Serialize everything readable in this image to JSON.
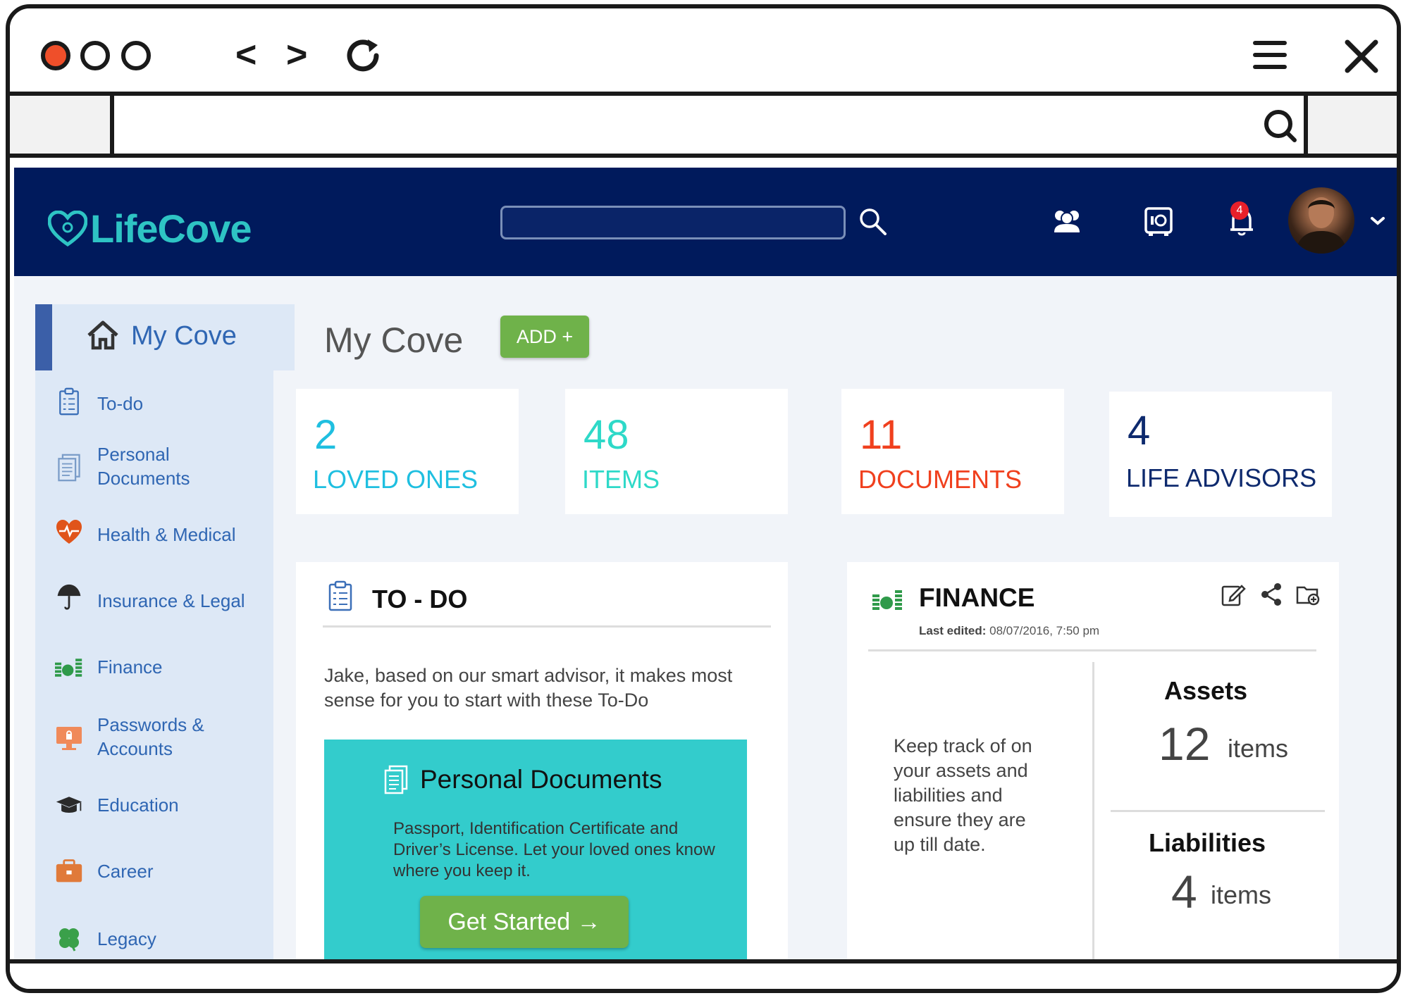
{
  "browser": {
    "nav_back": "<",
    "nav_forward": ">"
  },
  "header": {
    "logo_text": "LifeCove",
    "notification_count": "4"
  },
  "sidebar": {
    "active_label": "My Cove",
    "items": [
      {
        "label": "To-do",
        "icon": "clipboard-icon"
      },
      {
        "label": "Personal Documents",
        "icon": "documents-icon"
      },
      {
        "label": "Health & Medical",
        "icon": "heart-icon"
      },
      {
        "label": "Insurance & Legal",
        "icon": "umbrella-icon"
      },
      {
        "label": "Finance",
        "icon": "money-icon"
      },
      {
        "label": "Passwords & Accounts",
        "icon": "monitor-lock-icon"
      },
      {
        "label": "Education",
        "icon": "graduation-cap-icon"
      },
      {
        "label": "Career",
        "icon": "briefcase-icon"
      },
      {
        "label": "Legacy",
        "icon": "clover-icon"
      }
    ]
  },
  "main": {
    "title": "My Cove",
    "add_button": "ADD +",
    "stats": [
      {
        "value": "2",
        "label": "LOVED ONES",
        "color": "#1fbfe0"
      },
      {
        "value": "48",
        "label": "ITEMS",
        "color": "#2ed9c8"
      },
      {
        "value": "11",
        "label": "DOCUMENTS",
        "color": "#f0401e"
      },
      {
        "value": "4",
        "label": "LIFE ADVISORS",
        "color": "#0e2a6e"
      }
    ]
  },
  "todo": {
    "title": "TO - DO",
    "intro": "Jake, based on our smart advisor, it makes most sense for you to start with these To-Do",
    "card_title": "Personal Documents",
    "card_text": "Passport, Identification Certificate and Driver’s License. Let your loved ones know where you keep it.",
    "card_button": "Get Started →"
  },
  "finance": {
    "title": "FINANCE",
    "last_edited_label": "Last edited:",
    "last_edited_value": "08/07/2016, 7:50 pm",
    "description": "Keep track of on your assets and liabilities and ensure they are up till date.",
    "assets_label": "Assets",
    "assets_count": "12",
    "assets_unit": "items",
    "liabilities_label": "Liabilities",
    "liabilities_count": "4",
    "liabilities_unit": "items"
  }
}
